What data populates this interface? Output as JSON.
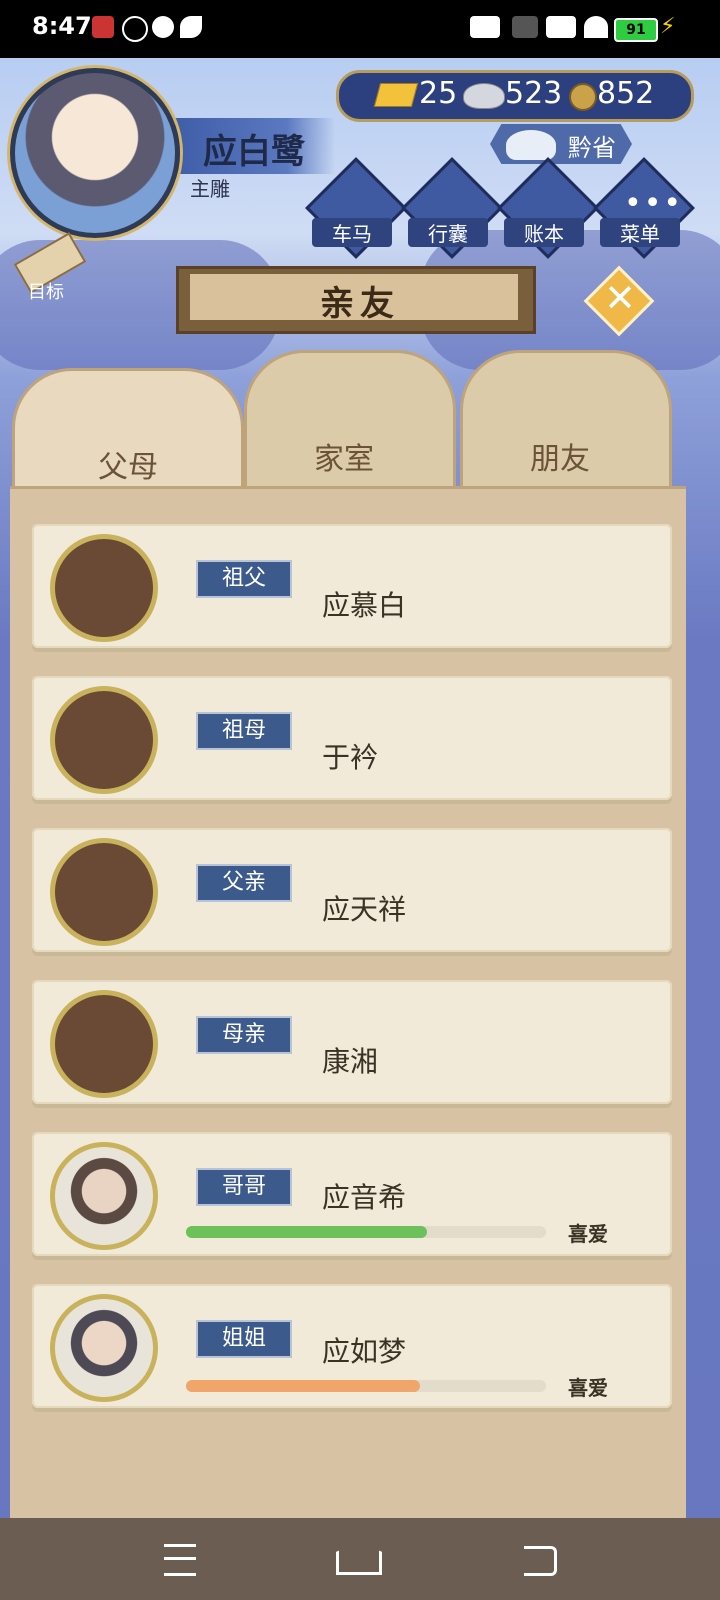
{
  "status_bar": {
    "time": "8:47",
    "battery": "91"
  },
  "player": {
    "name": "应白鹭",
    "title": "主雕"
  },
  "currency": {
    "gold": "25",
    "silver": "523",
    "coin": "852"
  },
  "location": "黔省",
  "menu": [
    {
      "label": "车马",
      "icon": "carriage-icon"
    },
    {
      "label": "行囊",
      "icon": "bag-icon"
    },
    {
      "label": "账本",
      "icon": "ledger-icon"
    },
    {
      "label": "菜单",
      "icon": "more-icon"
    }
  ],
  "target_label": "目标",
  "page_title": "亲友",
  "close_glyph": "✕",
  "tabs": [
    {
      "label": "父母",
      "active": true
    },
    {
      "label": "家室",
      "active": false
    },
    {
      "label": "朋友",
      "active": false
    }
  ],
  "rows": [
    {
      "relation": "祖父",
      "name": "应慕白",
      "deceased": true
    },
    {
      "relation": "祖母",
      "name": "于衿",
      "deceased": true
    },
    {
      "relation": "父亲",
      "name": "应天祥",
      "deceased": true
    },
    {
      "relation": "母亲",
      "name": "康湘",
      "deceased": true
    },
    {
      "relation": "哥哥",
      "name": "应音希",
      "deceased": false,
      "affinity_label": "喜爱",
      "affinity": 0.67,
      "bar_color": "#6cc15a"
    },
    {
      "relation": "姐姐",
      "name": "应如梦",
      "deceased": false,
      "affinity_label": "喜爱",
      "affinity": 0.65,
      "bar_color": "#f0a66a"
    }
  ]
}
